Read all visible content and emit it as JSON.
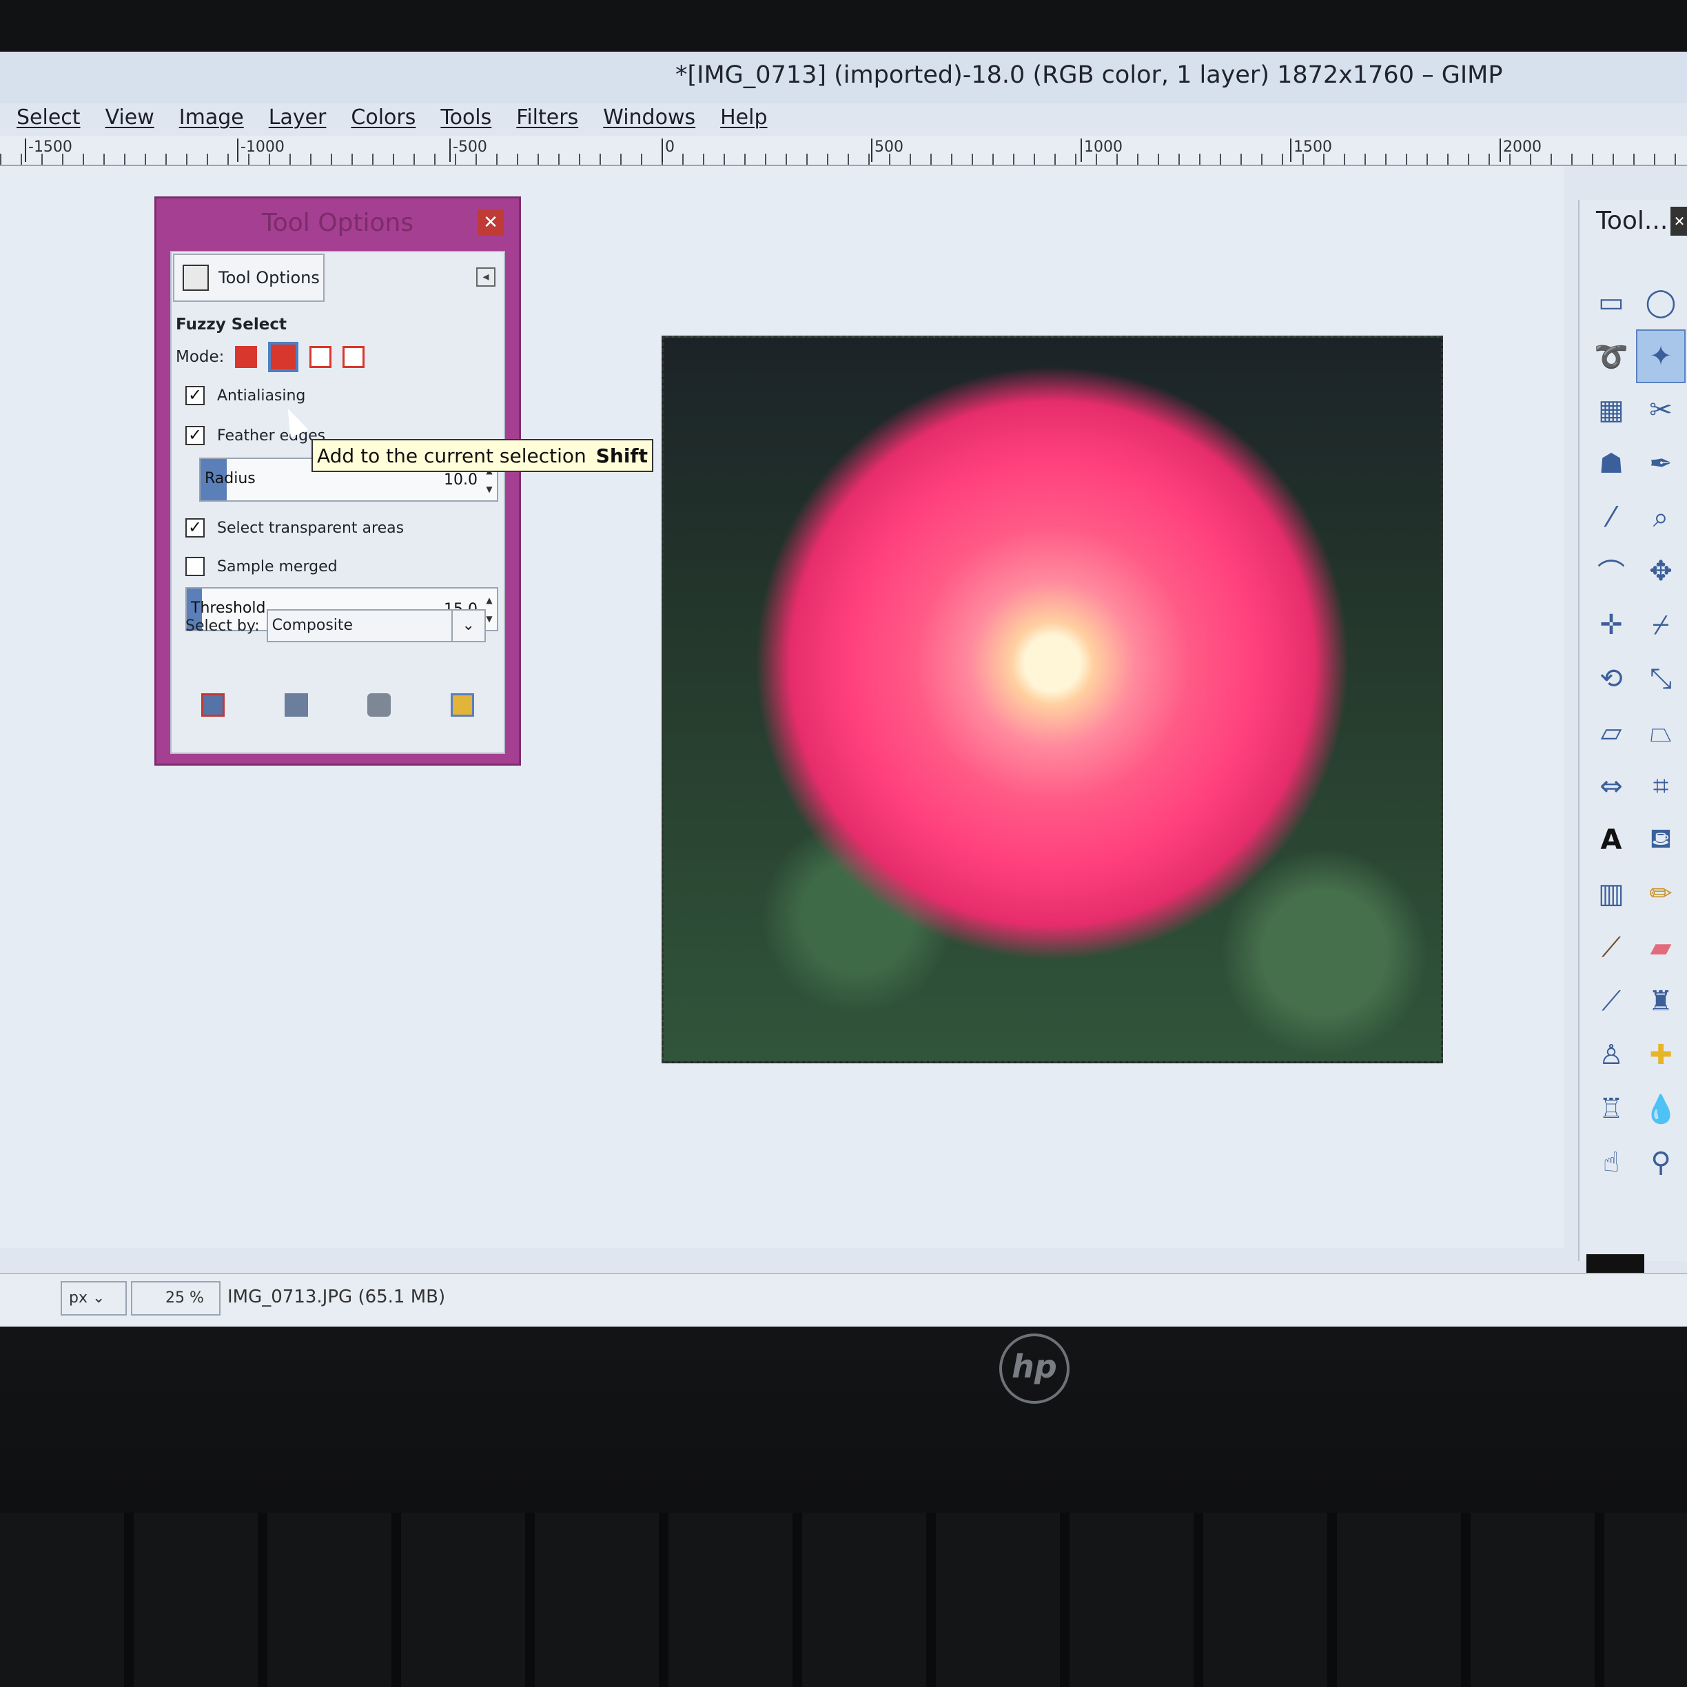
{
  "window": {
    "title": "*[IMG_0713] (imported)-18.0 (RGB color, 1 layer) 1872x1760 – GIMP"
  },
  "menu": [
    "Select",
    "View",
    "Image",
    "Layer",
    "Colors",
    "Tools",
    "Filters",
    "Windows",
    "Help"
  ],
  "ruler": {
    "labels": [
      "-1500",
      "-1000",
      "-500",
      "0",
      "500",
      "1000",
      "1500",
      "2000"
    ]
  },
  "tool_options": {
    "dialog_title": "Tool Options",
    "tab_label": "Tool Options",
    "tool_name": "Fuzzy Select",
    "mode_label": "Mode:",
    "antialiasing": {
      "label": "Antialiasing",
      "checked": true
    },
    "feather_edges": {
      "label": "Feather edges",
      "checked": true
    },
    "radius": {
      "label": "Radius",
      "value": "10.0"
    },
    "select_transparent": {
      "label": "Select transparent areas",
      "checked": true
    },
    "sample_merged": {
      "label": "Sample merged",
      "checked": false
    },
    "threshold": {
      "label": "Threshold",
      "value": "15.0"
    },
    "select_by": {
      "label": "Select by:",
      "value": "Composite"
    }
  },
  "tooltip": {
    "text": "Add to the current selection",
    "shortcut": "Shift"
  },
  "toolbox": {
    "title": "Tool..."
  },
  "status": {
    "unit": "px",
    "zoom": "25 %",
    "file_info": "IMG_0713.JPG (65.1 MB)"
  },
  "laptop": {
    "logo": "hp"
  },
  "colors": {
    "dialog_frame": "#a53f92",
    "accent_blue": "#5b7fb8",
    "mode_red": "#d8372e"
  }
}
